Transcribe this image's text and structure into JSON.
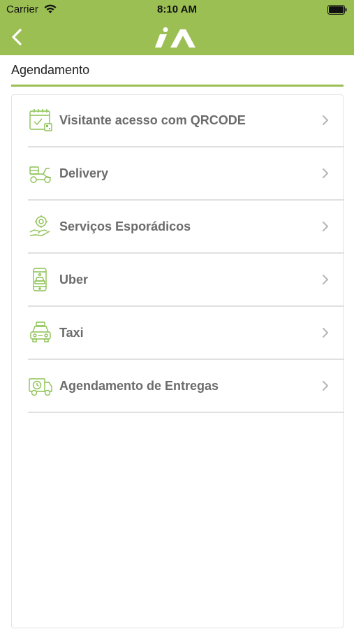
{
  "status_bar": {
    "carrier": "Carrier",
    "time": "8:10 AM"
  },
  "nav": {
    "logo_text": "iA",
    "back_icon": "chevron-left-icon",
    "color": "#9bbf53"
  },
  "section": {
    "title": "Agendamento"
  },
  "menu": {
    "items": [
      {
        "label": "Visitante acesso com QRCODE",
        "icon": "calendar-qr-icon"
      },
      {
        "label": "Delivery",
        "icon": "delivery-scooter-icon"
      },
      {
        "label": "Serviços Esporádicos",
        "icon": "service-hand-icon"
      },
      {
        "label": "Uber",
        "icon": "phone-car-icon"
      },
      {
        "label": "Taxi",
        "icon": "taxi-icon"
      },
      {
        "label": "Agendamento de Entregas",
        "icon": "delivery-truck-icon"
      }
    ]
  },
  "colors": {
    "accent": "#9bbf53",
    "text": "#6b6b6b",
    "divider": "#e0e0e0"
  }
}
